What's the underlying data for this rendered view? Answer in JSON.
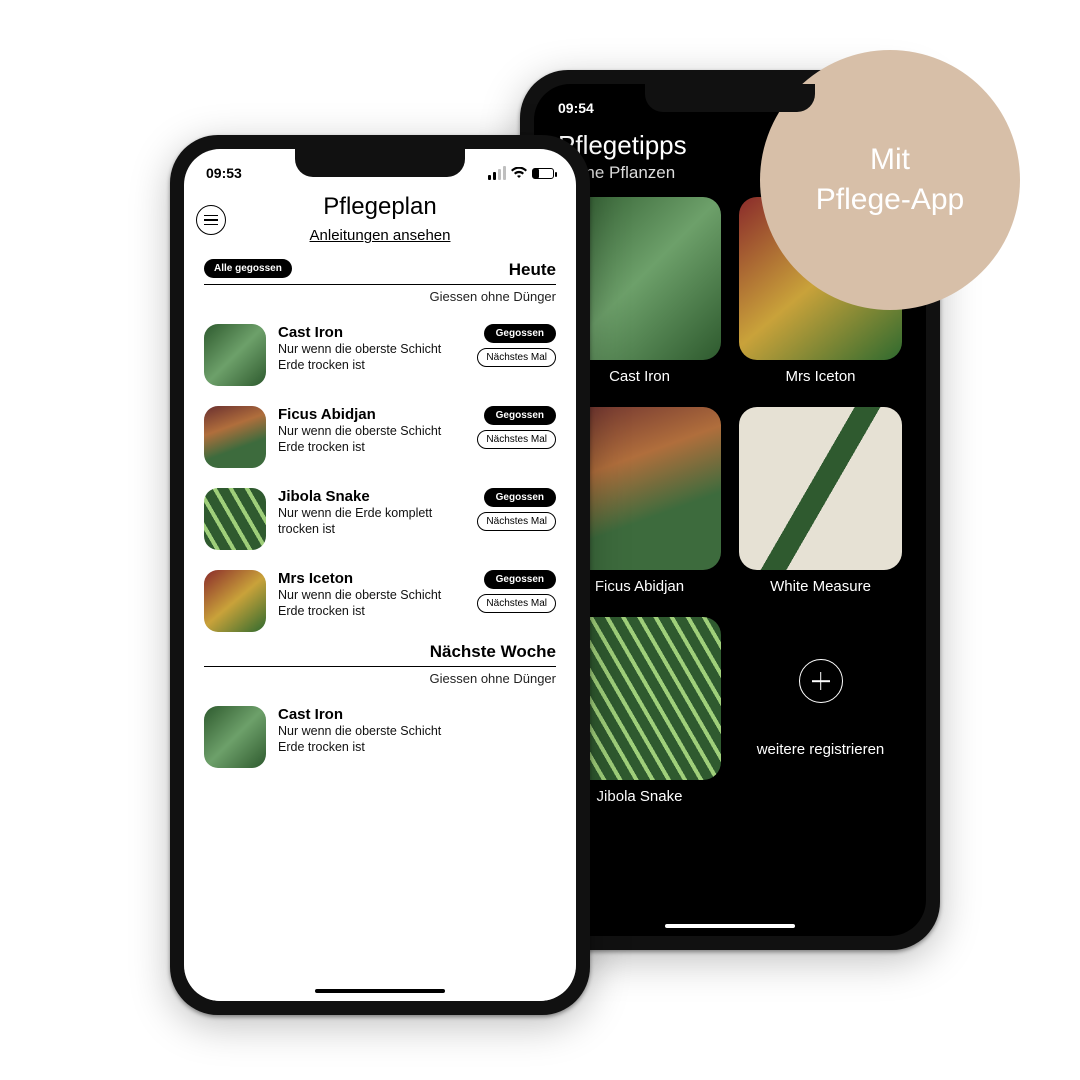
{
  "badge": {
    "line1": "Mit",
    "line2": "Pflege-App"
  },
  "phone2": {
    "time": "09:54",
    "title": "Pflegetipps",
    "subtitle": "Meine Pflanzen",
    "tiles": [
      {
        "name": "Cast Iron",
        "thumbClass": "cast-iron"
      },
      {
        "name": "Mrs Iceton",
        "thumbClass": "iceton"
      },
      {
        "name": "Ficus Abidjan",
        "thumbClass": "ficus"
      },
      {
        "name": "White Measure",
        "thumbClass": "white"
      },
      {
        "name": "Jibola Snake",
        "thumbClass": "jibola"
      }
    ],
    "addLabel": "weitere registrieren"
  },
  "phone1": {
    "time": "09:53",
    "title": "Pflegeplan",
    "link": "Anleitungen ansehen",
    "sections": [
      {
        "pill": "Alle gegossen",
        "day": "Heute",
        "sub": "Giessen ohne Dünger",
        "rows": [
          {
            "name": "Cast Iron",
            "desc": "Nur wenn die oberste Schicht Erde trocken ist",
            "b1": "Gegossen",
            "b2": "Nächstes Mal",
            "thumbClass": "cast-iron"
          },
          {
            "name": "Ficus Abidjan",
            "desc": "Nur wenn die oberste Schicht Erde trocken ist",
            "b1": "Gegossen",
            "b2": "Nächstes Mal",
            "thumbClass": "ficus"
          },
          {
            "name": "Jibola Snake",
            "desc": "Nur wenn die Erde komplett trocken ist",
            "b1": "Gegossen",
            "b2": "Nächstes Mal",
            "thumbClass": "jibola"
          },
          {
            "name": "Mrs Iceton",
            "desc": "Nur wenn die oberste Schicht Erde trocken ist",
            "b1": "Gegossen",
            "b2": "Nächstes Mal",
            "thumbClass": "iceton"
          }
        ]
      },
      {
        "pill": null,
        "day": "Nächste Woche",
        "sub": "Giessen ohne Dünger",
        "rows": [
          {
            "name": "Cast Iron",
            "desc": "Nur wenn die oberste Schicht Erde trocken ist",
            "b1": null,
            "b2": null,
            "thumbClass": "cast-iron"
          }
        ]
      }
    ]
  }
}
